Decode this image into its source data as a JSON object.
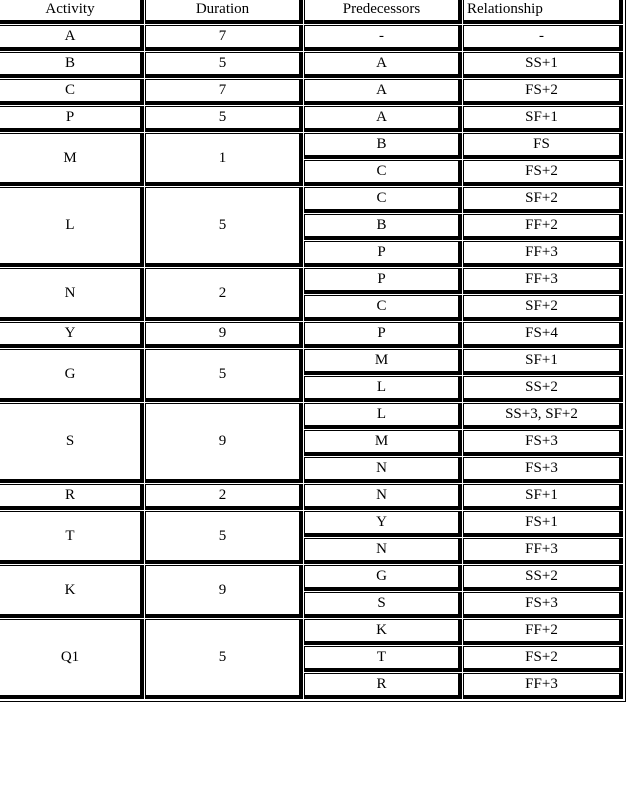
{
  "headers": {
    "activity": "Activity",
    "duration": "Duration",
    "predecessors": "Predecessors",
    "relationship": "Relationship"
  },
  "rows": [
    {
      "activity": "A",
      "duration": "7",
      "deps": [
        {
          "pred": "-",
          "rel": "-"
        }
      ]
    },
    {
      "activity": "B",
      "duration": "5",
      "deps": [
        {
          "pred": "A",
          "rel": "SS+1"
        }
      ]
    },
    {
      "activity": "C",
      "duration": "7",
      "deps": [
        {
          "pred": "A",
          "rel": "FS+2"
        }
      ]
    },
    {
      "activity": "P",
      "duration": "5",
      "deps": [
        {
          "pred": "A",
          "rel": "SF+1"
        }
      ]
    },
    {
      "activity": "M",
      "duration": "1",
      "deps": [
        {
          "pred": "B",
          "rel": "FS"
        },
        {
          "pred": "C",
          "rel": "FS+2"
        }
      ]
    },
    {
      "activity": "L",
      "duration": "5",
      "deps": [
        {
          "pred": "C",
          "rel": "SF+2"
        },
        {
          "pred": "B",
          "rel": "FF+2"
        },
        {
          "pred": "P",
          "rel": "FF+3"
        }
      ]
    },
    {
      "activity": "N",
      "duration": "2",
      "deps": [
        {
          "pred": "P",
          "rel": "FF+3"
        },
        {
          "pred": "C",
          "rel": "SF+2"
        }
      ]
    },
    {
      "activity": "Y",
      "duration": "9",
      "deps": [
        {
          "pred": "P",
          "rel": "FS+4"
        }
      ]
    },
    {
      "activity": "G",
      "duration": "5",
      "deps": [
        {
          "pred": "M",
          "rel": "SF+1"
        },
        {
          "pred": "L",
          "rel": "SS+2"
        }
      ]
    },
    {
      "activity": "S",
      "duration": "9",
      "deps": [
        {
          "pred": "L",
          "rel": "SS+3, SF+2"
        },
        {
          "pred": "M",
          "rel": "FS+3"
        },
        {
          "pred": "N",
          "rel": "FS+3"
        }
      ]
    },
    {
      "activity": "R",
      "duration": "2",
      "deps": [
        {
          "pred": "N",
          "rel": "SF+1"
        }
      ]
    },
    {
      "activity": "T",
      "duration": "5",
      "deps": [
        {
          "pred": "Y",
          "rel": "FS+1"
        },
        {
          "pred": "N",
          "rel": "FF+3"
        }
      ]
    },
    {
      "activity": "K",
      "duration": "9",
      "deps": [
        {
          "pred": "G",
          "rel": "SS+2"
        },
        {
          "pred": "S",
          "rel": "FS+3"
        }
      ]
    },
    {
      "activity": "Q1",
      "duration": "5",
      "deps": [
        {
          "pred": "K",
          "rel": "FF+2"
        },
        {
          "pred": "T",
          "rel": "FS+2"
        },
        {
          "pred": "R",
          "rel": "FF+3"
        }
      ]
    }
  ]
}
